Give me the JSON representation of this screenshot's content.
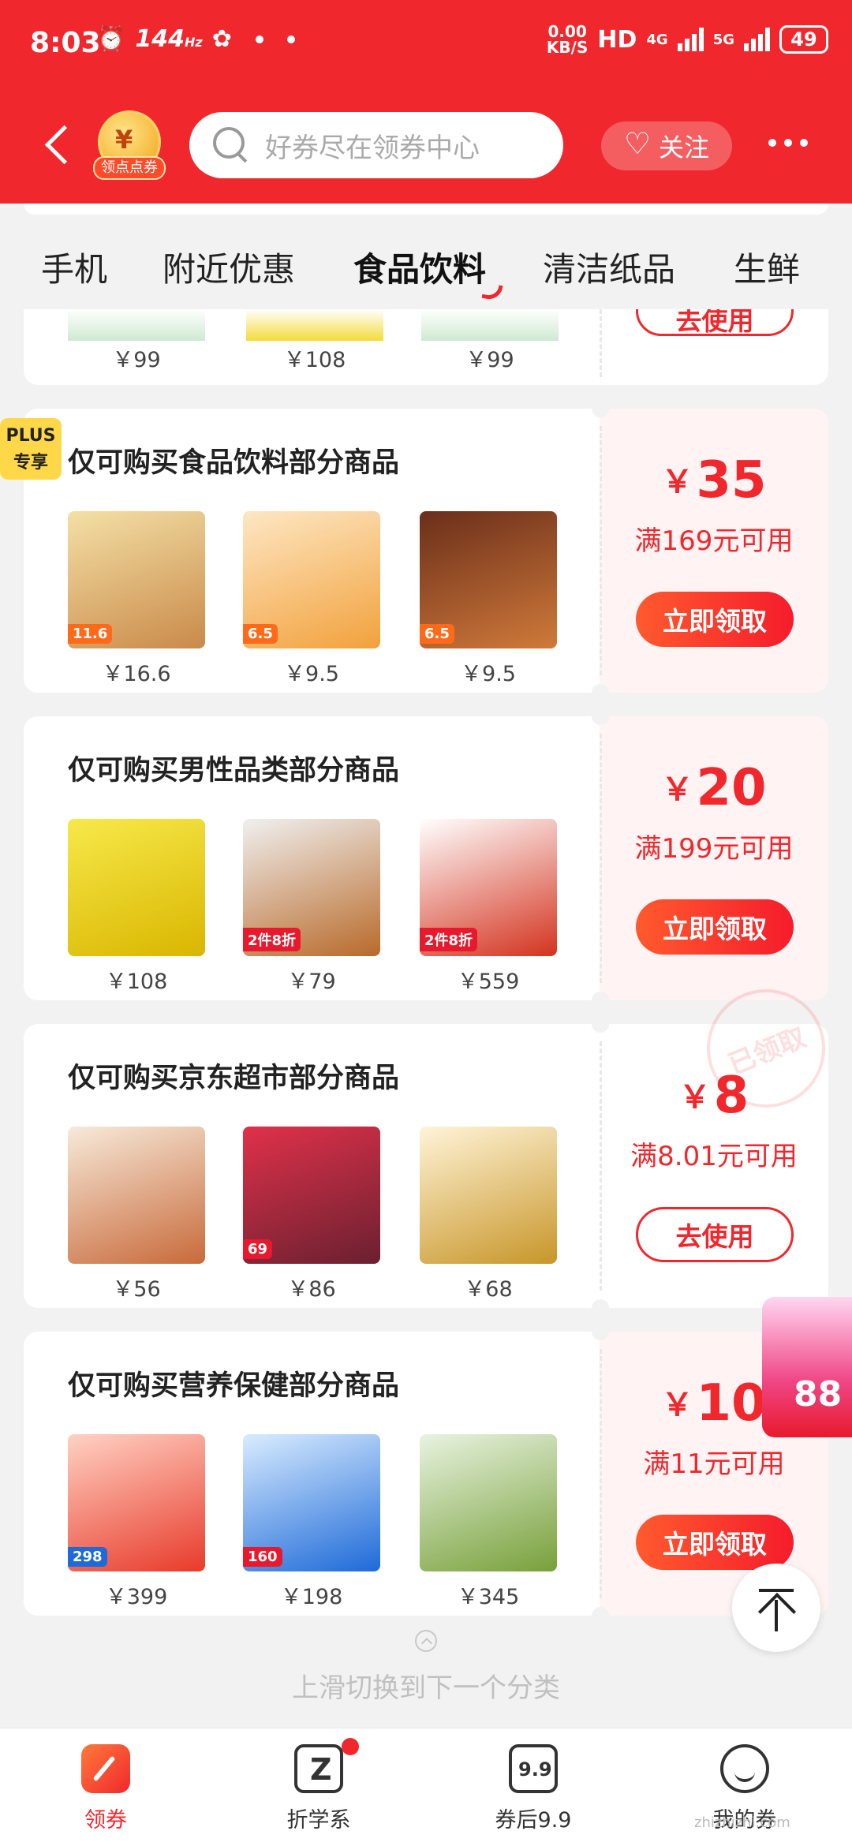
{
  "status_bar": {
    "time": "8:03",
    "refresh": "144",
    "refresh_unit": "Hz",
    "speed_value": "0.00",
    "speed_unit": "KB/S",
    "hd": "HD",
    "net1": "4G",
    "net2": "5G",
    "battery": "49"
  },
  "header": {
    "badge_label": "领点点券",
    "badge_symbol": "¥",
    "search_placeholder": "好券尽在领券中心",
    "follow_label": "关注",
    "accent_color": "#f0282d"
  },
  "tabs": [
    {
      "label": "手机",
      "active": false
    },
    {
      "label": "附近优惠",
      "active": false
    },
    {
      "label": "食品饮料",
      "active": true
    },
    {
      "label": "清洁纸品",
      "active": false
    },
    {
      "label": "生鲜",
      "active": false
    }
  ],
  "partial_card": {
    "prices": [
      "￥99",
      "￥108",
      "￥99"
    ],
    "button": "去使用"
  },
  "coupons": [
    {
      "title": "仅可购买食品饮料部分商品",
      "plus_badge": [
        "PLUS",
        "专享"
      ],
      "amount_symbol": "￥",
      "amount": "35",
      "condition": "满169元可用",
      "button": "立即领取",
      "button_type": "claim",
      "products": [
        {
          "price": "￥16.6",
          "tag": "11.6"
        },
        {
          "price": "￥9.5",
          "tag": "6.5"
        },
        {
          "price": "￥9.5",
          "tag": "6.5"
        }
      ]
    },
    {
      "title": "仅可购买男性品类部分商品",
      "amount_symbol": "￥",
      "amount": "20",
      "condition": "满199元可用",
      "button": "立即领取",
      "button_type": "claim",
      "products": [
        {
          "price": "￥108"
        },
        {
          "price": "￥79",
          "tag": "2件8折"
        },
        {
          "price": "￥559",
          "tag": "2件8折"
        }
      ]
    },
    {
      "title": "仅可购买京东超市部分商品",
      "amount_symbol": "￥",
      "amount": "8",
      "condition": "满8.01元可用",
      "button": "去使用",
      "button_type": "use",
      "stamp": "已领取",
      "products": [
        {
          "price": "￥56"
        },
        {
          "price": "￥86",
          "tag": "69"
        },
        {
          "price": "￥68"
        }
      ]
    },
    {
      "title": "仅可购买营养保健部分商品",
      "amount_symbol": "￥",
      "amount": "10",
      "condition": "满11元可用",
      "button": "立即领取",
      "button_type": "claim",
      "products": [
        {
          "price": "￥399",
          "tag": "298"
        },
        {
          "price": "￥198",
          "tag": "160"
        },
        {
          "price": "￥345"
        }
      ]
    }
  ],
  "floating": {
    "red_packet_number": "88"
  },
  "swipe_hint": "上滑切换到下一个分类",
  "bottom_nav": [
    {
      "label": "领券",
      "icon": "coupon-icon",
      "active": true
    },
    {
      "label": "折学系",
      "icon": "z-icon",
      "active": false,
      "dot": true
    },
    {
      "label": "券后9.9",
      "icon": "nine-nine-icon",
      "active": false
    },
    {
      "label": "我的券",
      "icon": "face-icon",
      "active": false
    }
  ],
  "watermark": "zhizhizhi.com"
}
